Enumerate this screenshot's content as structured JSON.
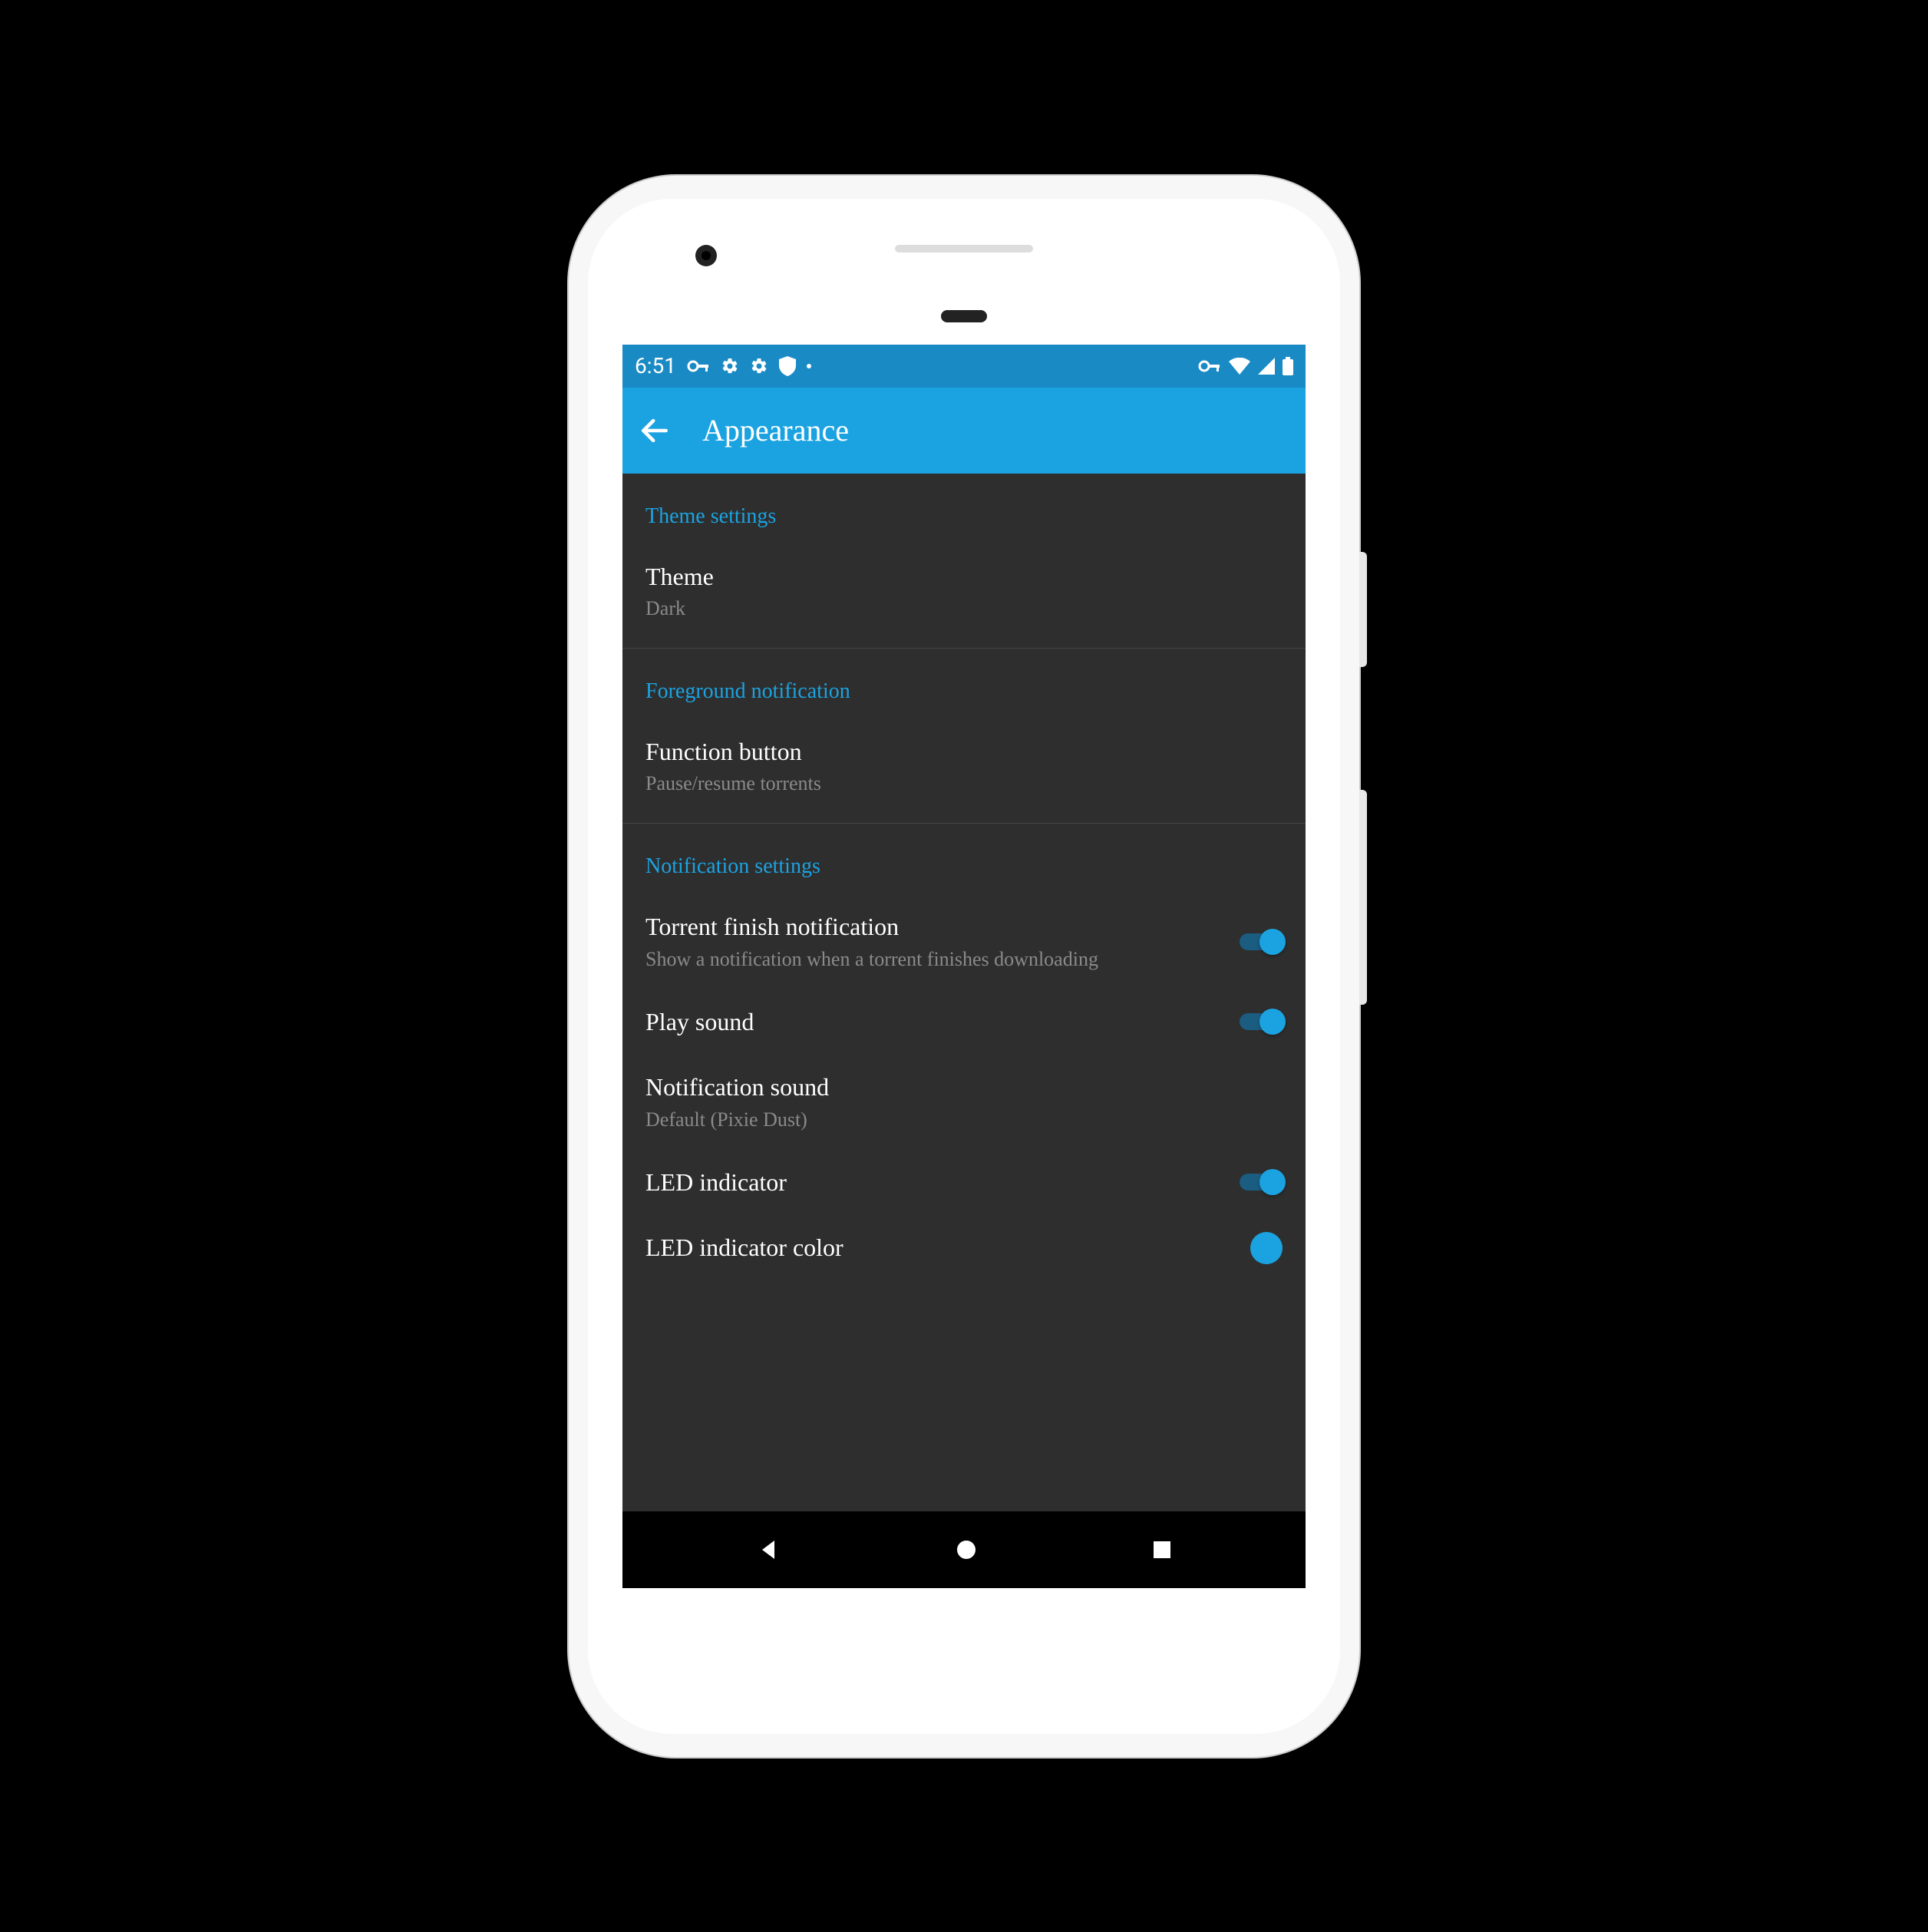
{
  "status_bar": {
    "time": "6:51"
  },
  "app_bar": {
    "title": "Appearance"
  },
  "sections": {
    "theme": {
      "header": "Theme settings",
      "theme_item": {
        "title": "Theme",
        "sub": "Dark"
      }
    },
    "foreground": {
      "header": "Foreground notification",
      "function_button": {
        "title": "Function button",
        "sub": "Pause/resume torrents"
      }
    },
    "notifications": {
      "header": "Notification settings",
      "finish": {
        "title": "Torrent finish notification",
        "sub": "Show a notification when a torrent finishes downloading"
      },
      "play_sound": {
        "title": "Play sound"
      },
      "sound": {
        "title": "Notification sound",
        "sub": "Default (Pixie Dust)"
      },
      "led": {
        "title": "LED indicator"
      },
      "led_color": {
        "title": "LED indicator color"
      }
    }
  },
  "colors": {
    "accent": "#1ba3e1",
    "led": "#1ba3e1"
  }
}
